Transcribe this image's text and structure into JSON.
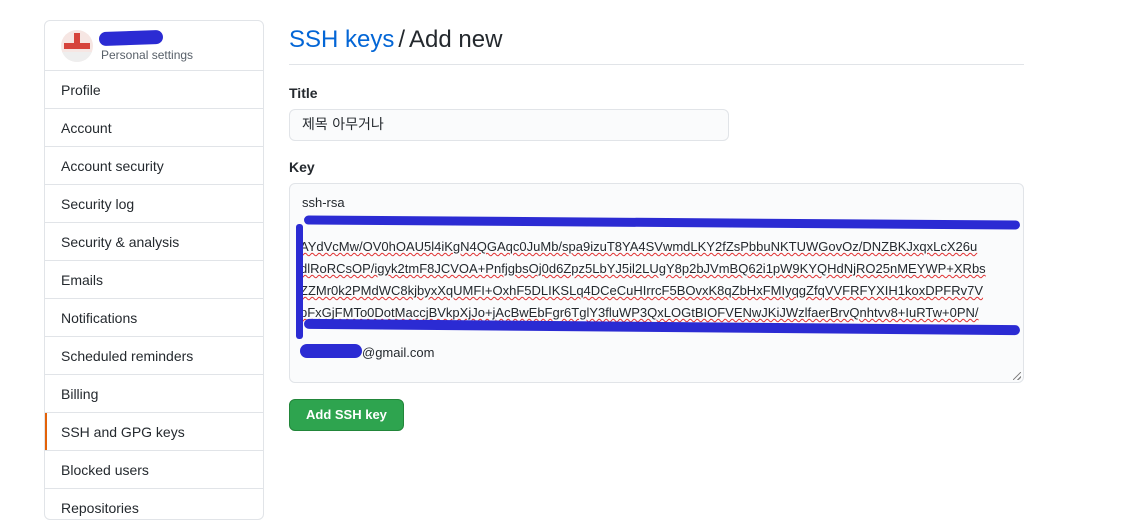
{
  "sidebar": {
    "header_subtitle": "Personal settings",
    "items": [
      {
        "label": "Profile"
      },
      {
        "label": "Account"
      },
      {
        "label": "Account security"
      },
      {
        "label": "Security log"
      },
      {
        "label": "Security & analysis"
      },
      {
        "label": "Emails"
      },
      {
        "label": "Notifications"
      },
      {
        "label": "Scheduled reminders"
      },
      {
        "label": "Billing"
      },
      {
        "label": "SSH and GPG keys",
        "selected": true
      },
      {
        "label": "Blocked users"
      },
      {
        "label": "Repositories"
      }
    ]
  },
  "main": {
    "breadcrumb_link": "SSH keys",
    "breadcrumb_sep": "/",
    "breadcrumb_current": "Add new",
    "title_label": "Title",
    "title_value": "제목 아무거나",
    "key_label": "Key",
    "key_lines": [
      "ssh-rsa",
      "AYdVcMw/OV0hOAU5l4iKgN4QGAqc0JuMb/spa9izuT8YA4SVwmdLKY2fZsPbbuNKTUWGovOz/DNZBKJxqxLcX26u",
      "dlRoRCsOP/igyk2tmF8JCVOA+PnfjgbsOj0d6Zpz5LbYJ5il2LUgY8p2bJVmBQ62i1pW9KYQHdNjRO25nMEYWP+XRbs",
      "ZZMr0k2PMdWC8kjbyxXqUMFI+OxhF5DLIKSLq4DCeCuHIrrcF5BOvxK8qZbHxFMIyqgZfqVVFRFYXIH1koxDPFRv7V",
      "pFxGjFMTo0DotMaccjBVkpXjJo+jAcBwEbFgr6TglY3fluWP3QxLOGtBIOFVENwJKiJWzlfaerBrvQnhtvv8+IuRTw+0PN/",
      "@gmail.com"
    ],
    "submit_label": "Add SSH key"
  },
  "colors": {
    "link": "#0366d6",
    "button_green": "#2ea44f",
    "selected_marker": "#e36209",
    "redaction": "#2b2bd3"
  }
}
